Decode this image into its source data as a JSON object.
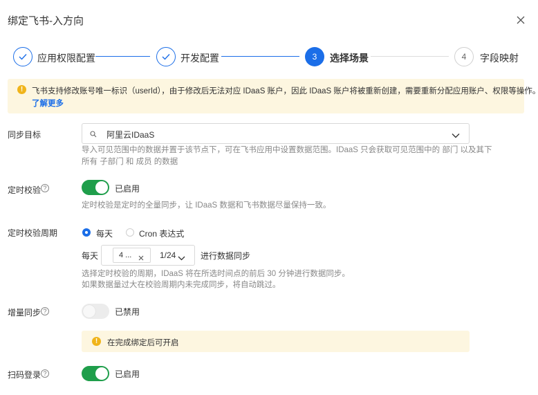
{
  "dialog": {
    "title": "绑定飞书-入方向"
  },
  "steps": [
    {
      "label": "应用权限配置",
      "state": "done"
    },
    {
      "label": "开发配置",
      "state": "done"
    },
    {
      "number": "3",
      "label": "选择场景",
      "state": "active"
    },
    {
      "number": "4",
      "label": "字段映射",
      "state": "todo"
    }
  ],
  "alert": {
    "text": "飞书支持修改账号唯一标识（userId），由于修改后无法对应 IDaaS 账户，因此 IDaaS 账户将被重新创建，需要重新分配应用账户、权限等操作。",
    "link": "了解更多"
  },
  "sync_target": {
    "label": "同步目标",
    "value": "阿里云IDaaS",
    "desc_line1": "导入可见范围中的数据并置于该节点下，可在飞书应用中设置数据范围。IDaaS 只会获取可见范围中的 部门 以及其下",
    "desc_line2": "所有 子部门 和 成员 的数据"
  },
  "scheduled_check": {
    "label": "定时校验",
    "status": "已启用",
    "enabled": true,
    "desc": "定时校验是定时的全量同步，让 IDaaS 数据和飞书数据尽量保持一致。"
  },
  "check_period": {
    "label": "定时校验周期",
    "option_daily": "每天",
    "option_cron": "Cron 表达式",
    "selected": "每天",
    "prefix": "每天",
    "tag_value": "4 ...",
    "count": "1/24",
    "suffix": "进行数据同步",
    "desc_line1": "选择定时校验的周期，IDaaS 将在所选时间点的前后 30 分钟进行数据同步。",
    "desc_line2": "如果数据量过大在校验周期内未完成同步，将自动跳过。"
  },
  "incremental_sync": {
    "label": "增量同步",
    "status": "已禁用",
    "enabled": false,
    "note": "在完成绑定后可开启"
  },
  "qr_login": {
    "label": "扫码登录",
    "status": "已启用",
    "enabled": true
  },
  "colors": {
    "accent": "#1b6ee8",
    "toggle_on": "#1f9e4b",
    "warning": "#f0b41a",
    "alert_bg": "#fdf6e0"
  }
}
